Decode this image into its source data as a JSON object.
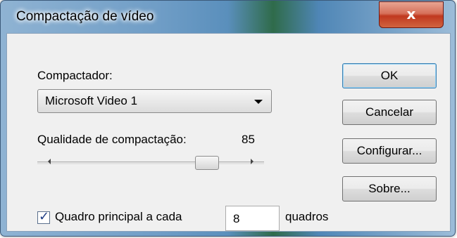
{
  "window": {
    "title": "Compactação de vídeo",
    "close_label": "x"
  },
  "compressor": {
    "label": "Compactador:",
    "selected": "Microsoft Video 1"
  },
  "quality": {
    "label": "Qualidade de compactação:",
    "value_text": "85",
    "level": 0.85
  },
  "keyframe": {
    "checked": true,
    "label": "Quadro principal a cada",
    "value": "8",
    "unit": "quadros"
  },
  "buttons": {
    "ok": "OK",
    "cancel": "Cancelar",
    "configure": "Configurar...",
    "about": "Sobre..."
  }
}
